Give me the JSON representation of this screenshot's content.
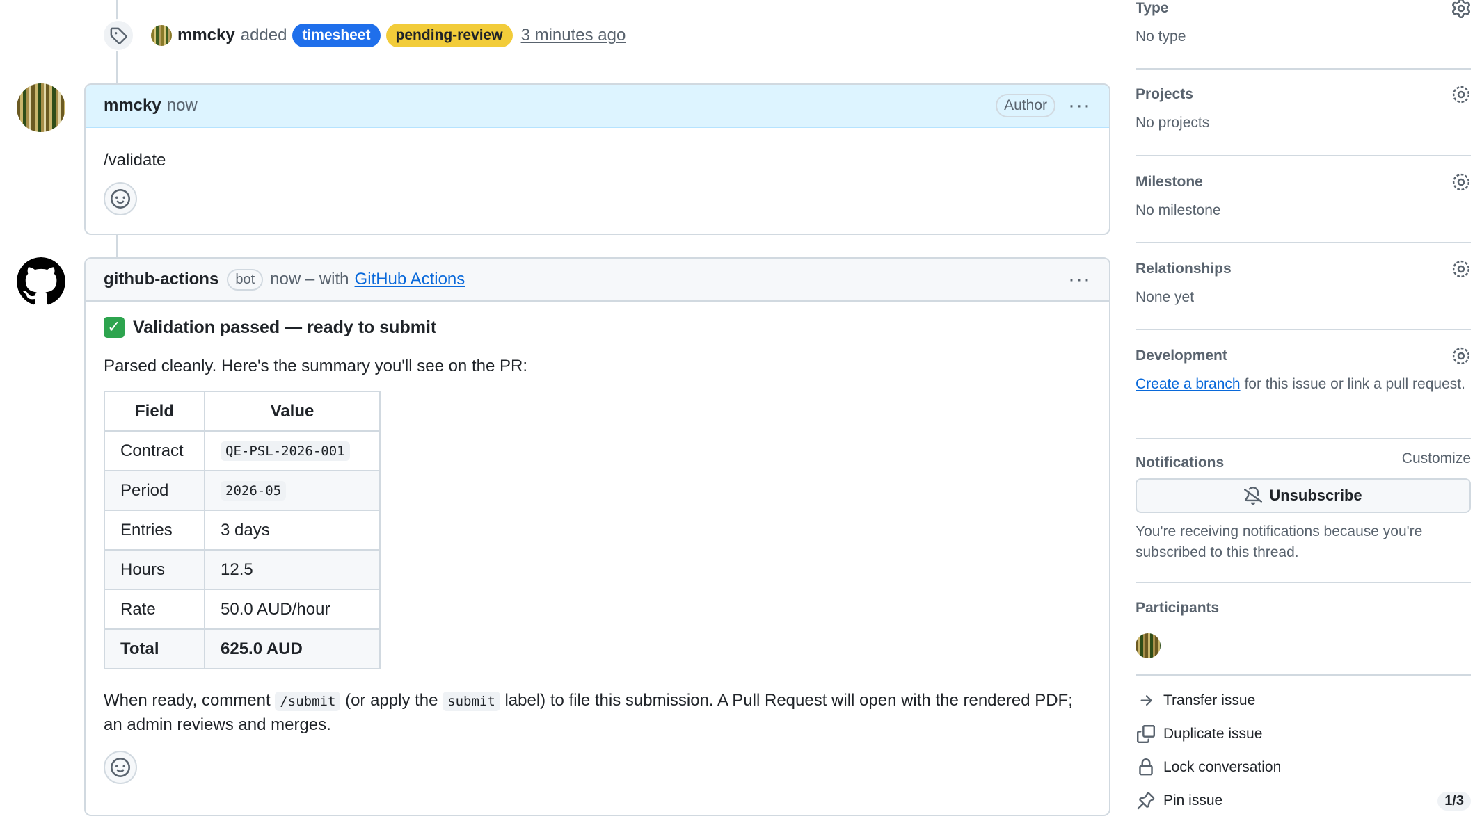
{
  "event": {
    "actor": "mmcky",
    "verb": "added",
    "labels": [
      "timesheet",
      "pending-review"
    ],
    "time": "3 minutes ago"
  },
  "comment1": {
    "author": "mmcky",
    "time": "now",
    "badge": "Author",
    "body": "/validate"
  },
  "comment2": {
    "author": "github-actions",
    "bot_badge": "bot",
    "time_prefix": "now – with",
    "app_link": "GitHub Actions",
    "heading": "Validation passed — ready to submit",
    "intro": "Parsed cleanly. Here's the summary you'll see on the PR:",
    "table": {
      "headers": [
        "Field",
        "Value"
      ],
      "rows": [
        {
          "field": "Contract",
          "value": "QE-PSL-2026-001",
          "code": true
        },
        {
          "field": "Period",
          "value": "2026-05",
          "code": true
        },
        {
          "field": "Entries",
          "value": "3 days",
          "code": false
        },
        {
          "field": "Hours",
          "value": "12.5",
          "code": false
        },
        {
          "field": "Rate",
          "value": "50.0 AUD/hour",
          "code": false
        },
        {
          "field": "Total",
          "value": "625.0 AUD",
          "code": false
        }
      ]
    },
    "outro_1": "When ready, comment",
    "outro_code1": "/submit",
    "outro_2": "(or apply the",
    "outro_code2": "submit",
    "outro_3": "label) to file this submission. A Pull Request will open with the rendered PDF; an admin reviews and merges."
  },
  "sidebar": {
    "type": {
      "title": "Type",
      "value": "No type"
    },
    "projects": {
      "title": "Projects",
      "value": "No projects"
    },
    "milestone": {
      "title": "Milestone",
      "value": "No milestone"
    },
    "relationships": {
      "title": "Relationships",
      "value": "None yet"
    },
    "development": {
      "title": "Development",
      "link": "Create a branch",
      "rest": "for this issue or link a pull request."
    },
    "notifications": {
      "title": "Notifications",
      "customize": "Customize",
      "button": "Unsubscribe",
      "note": "You're receiving notifications because you're subscribed to this thread."
    },
    "participants": {
      "title": "Participants"
    },
    "actions": {
      "transfer": "Transfer issue",
      "duplicate": "Duplicate issue",
      "lock": "Lock conversation",
      "pin": "Pin issue",
      "pin_count": "1/3"
    }
  },
  "colors": {
    "accent": "#0969da",
    "label_timesheet": "#1f6feb",
    "label_pending": "#f2cc3a",
    "success": "#2da44e"
  }
}
